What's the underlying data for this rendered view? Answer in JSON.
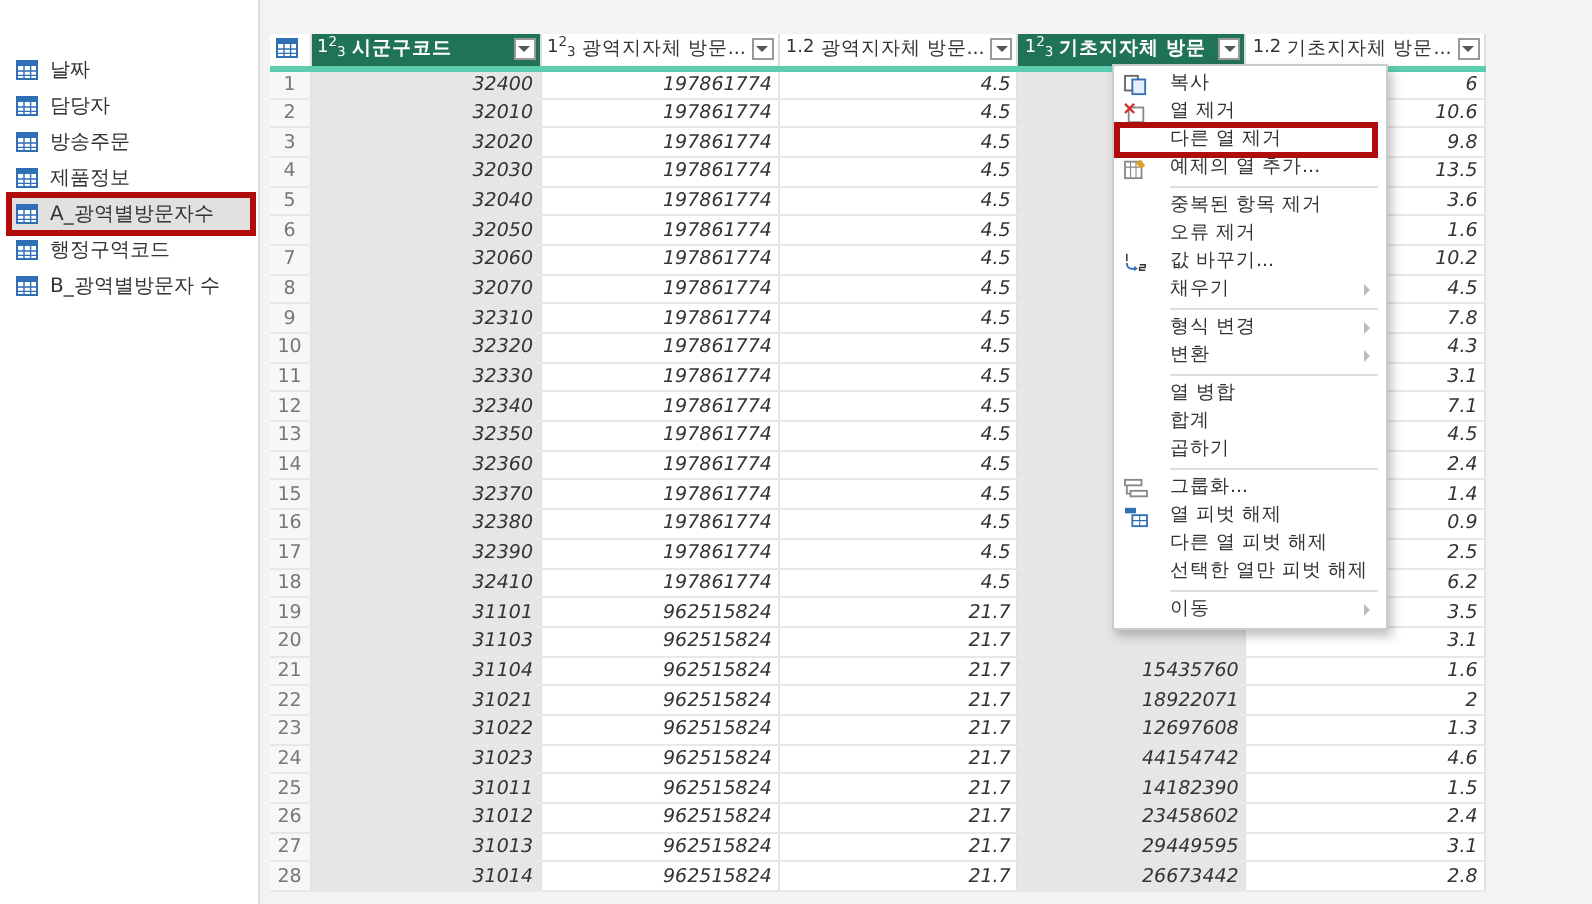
{
  "queries": [
    {
      "label": "날짜",
      "selected": false,
      "highlighted": false
    },
    {
      "label": "담당자",
      "selected": false,
      "highlighted": false
    },
    {
      "label": "방송주문",
      "selected": false,
      "highlighted": false
    },
    {
      "label": "제품정보",
      "selected": false,
      "highlighted": false
    },
    {
      "label": "A_광역별방문자수",
      "selected": true,
      "highlighted": true
    },
    {
      "label": "행정구역코드",
      "selected": false,
      "highlighted": false
    },
    {
      "label": "B_광역별방문자 수",
      "selected": false,
      "highlighted": false
    }
  ],
  "table": {
    "columns": [
      {
        "kind": "row-header"
      },
      {
        "type": "1$^{2}$$_{3}$",
        "name": "시군구코드",
        "selected": true
      },
      {
        "type": "1$^{2}$$_{3}$",
        "name": "광역지자체 방문...",
        "selected": false
      },
      {
        "type": "1.2",
        "name": "광역지자체 방문...",
        "selected": false
      },
      {
        "type": "1$^{2}$$_{3}$",
        "name": "기초지자체 방문",
        "selected": true
      },
      {
        "type": "1.2",
        "name": "기초지자체 방문...",
        "selected": false
      }
    ],
    "rows": [
      [
        "1",
        "32400",
        "197861774",
        "4.5",
        null,
        "6"
      ],
      [
        "2",
        "32010",
        "197861774",
        "4.5",
        null,
        "10.6"
      ],
      [
        "3",
        "32020",
        "197861774",
        "4.5",
        null,
        "9.8"
      ],
      [
        "4",
        "32030",
        "197861774",
        "4.5",
        null,
        "13.5"
      ],
      [
        "5",
        "32040",
        "197861774",
        "4.5",
        null,
        "3.6"
      ],
      [
        "6",
        "32050",
        "197861774",
        "4.5",
        null,
        "1.6"
      ],
      [
        "7",
        "32060",
        "197861774",
        "4.5",
        null,
        "10.2"
      ],
      [
        "8",
        "32070",
        "197861774",
        "4.5",
        null,
        "4.5"
      ],
      [
        "9",
        "32310",
        "197861774",
        "4.5",
        null,
        "7.8"
      ],
      [
        "10",
        "32320",
        "197861774",
        "4.5",
        null,
        "4.3"
      ],
      [
        "11",
        "32330",
        "197861774",
        "4.5",
        null,
        "3.1"
      ],
      [
        "12",
        "32340",
        "197861774",
        "4.5",
        null,
        "7.1"
      ],
      [
        "13",
        "32350",
        "197861774",
        "4.5",
        null,
        "4.5"
      ],
      [
        "14",
        "32360",
        "197861774",
        "4.5",
        null,
        "2.4"
      ],
      [
        "15",
        "32370",
        "197861774",
        "4.5",
        null,
        "1.4"
      ],
      [
        "16",
        "32380",
        "197861774",
        "4.5",
        null,
        "0.9"
      ],
      [
        "17",
        "32390",
        "197861774",
        "4.5",
        null,
        "2.5"
      ],
      [
        "18",
        "32410",
        "197861774",
        "4.5",
        null,
        "6.2"
      ],
      [
        "19",
        "31101",
        "962515824",
        "21.7",
        null,
        "3.5"
      ],
      [
        "20",
        "31103",
        "962515824",
        "21.7",
        null,
        "3.1"
      ],
      [
        "21",
        "31104",
        "962515824",
        "21.7",
        "15435760",
        "1.6"
      ],
      [
        "22",
        "31021",
        "962515824",
        "21.7",
        "18922071",
        "2"
      ],
      [
        "23",
        "31022",
        "962515824",
        "21.7",
        "12697608",
        "1.3"
      ],
      [
        "24",
        "31023",
        "962515824",
        "21.7",
        "44154742",
        "4.6"
      ],
      [
        "25",
        "31011",
        "962515824",
        "21.7",
        "14182390",
        "1.5"
      ],
      [
        "26",
        "31012",
        "962515824",
        "21.7",
        "23458602",
        "2.4"
      ],
      [
        "27",
        "31013",
        "962515824",
        "21.7",
        "29449595",
        "3.1"
      ],
      [
        "28",
        "31014",
        "962515824",
        "21.7",
        "26673442",
        "2.8"
      ]
    ]
  },
  "context_menu": [
    {
      "kind": "copy",
      "label": "복사",
      "submenu": false,
      "highlighted": false
    },
    {
      "kind": "remove",
      "label": "열 제거",
      "submenu": false,
      "highlighted": false
    },
    {
      "kind": "plain",
      "label": "다른 열 제거",
      "submenu": false,
      "highlighted": true
    },
    {
      "kind": "example",
      "label": "예제의 열 추가...",
      "submenu": false,
      "highlighted": false
    },
    {
      "kind": "separator"
    },
    {
      "kind": "plain",
      "label": "중복된 항목 제거",
      "submenu": false,
      "highlighted": false
    },
    {
      "kind": "plain",
      "label": "오류 제거",
      "submenu": false,
      "highlighted": false
    },
    {
      "kind": "replace",
      "label": "값 바꾸기...",
      "submenu": false,
      "highlighted": false
    },
    {
      "kind": "plain",
      "label": "채우기",
      "submenu": true,
      "highlighted": false
    },
    {
      "kind": "separator"
    },
    {
      "kind": "plain",
      "label": "형식 변경",
      "submenu": true,
      "highlighted": false
    },
    {
      "kind": "plain",
      "label": "변환",
      "submenu": true,
      "highlighted": false
    },
    {
      "kind": "separator"
    },
    {
      "kind": "plain",
      "label": "열 병합",
      "submenu": false,
      "highlighted": false
    },
    {
      "kind": "plain",
      "label": "합계",
      "submenu": false,
      "highlighted": false
    },
    {
      "kind": "plain",
      "label": "곱하기",
      "submenu": false,
      "highlighted": false
    },
    {
      "kind": "separator"
    },
    {
      "kind": "group",
      "label": "그룹화...",
      "submenu": false,
      "highlighted": false
    },
    {
      "kind": "unpivot",
      "label": "열 피벗 해제",
      "submenu": false,
      "highlighted": false
    },
    {
      "kind": "plain",
      "label": "다른 열 피벗 해제",
      "submenu": false,
      "highlighted": false
    },
    {
      "kind": "plain",
      "label": "선택한 열만 피벗 해제",
      "submenu": false,
      "highlighted": false
    },
    {
      "kind": "separator"
    },
    {
      "kind": "plain",
      "label": "이동",
      "submenu": true,
      "highlighted": false
    }
  ]
}
